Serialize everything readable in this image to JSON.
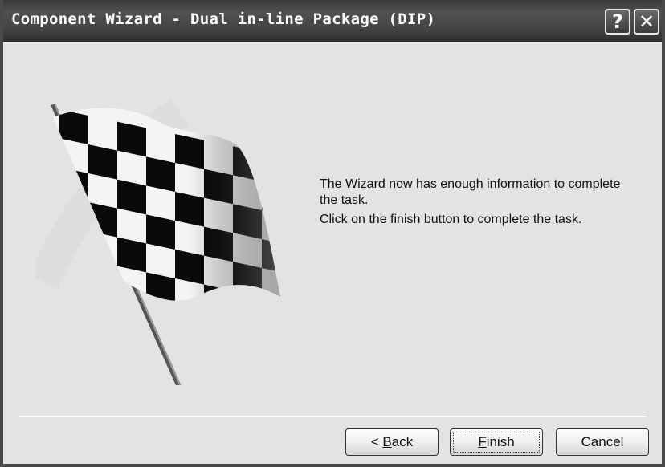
{
  "window": {
    "title": "Component Wizard - Dual in-line Package (DIP)",
    "help_icon_glyph": "?",
    "close_icon_glyph": "✕",
    "colors": {
      "titlebar": "#444444",
      "content_bg": "#e3e3e3",
      "text": "#111111"
    }
  },
  "message": {
    "line1": "The Wizard now has enough information to complete the task.",
    "line2": "Click on the finish button to complete the task."
  },
  "buttons": {
    "back_prefix": "< ",
    "back_mnemonic": "B",
    "back_rest": "ack",
    "finish_mnemonic": "F",
    "finish_rest": "inish",
    "cancel": "Cancel"
  },
  "illustration": {
    "icon": "checkered-flag-icon"
  }
}
